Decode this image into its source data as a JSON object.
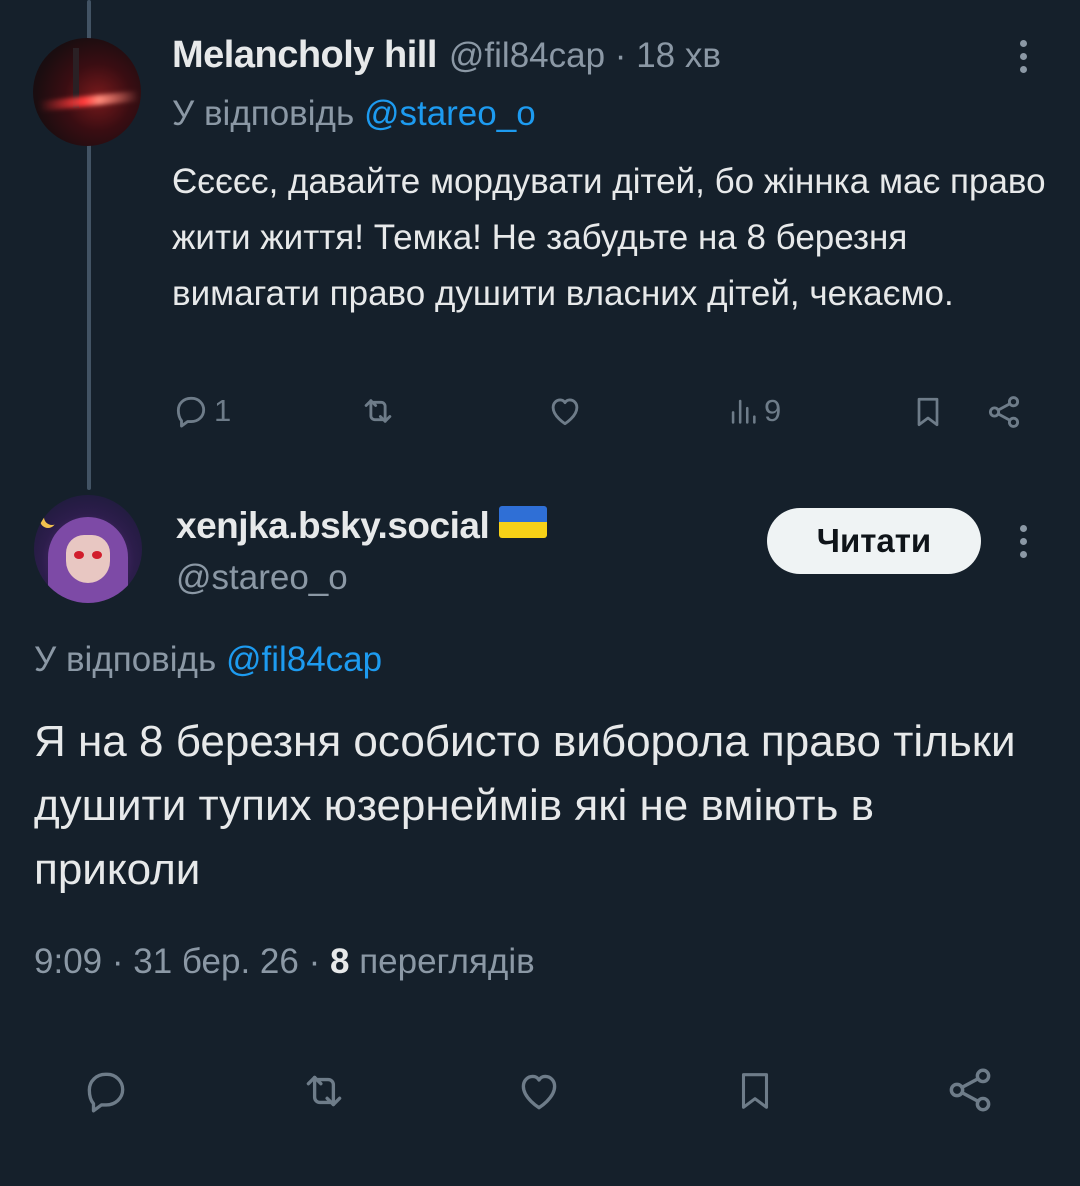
{
  "parent_tweet": {
    "display_name": "Melancholy hill",
    "handle": "@fil84cap",
    "time": "18 хв",
    "separator": "·",
    "reply_label": "У відповідь",
    "reply_handle": "@stareo_o",
    "text": "Єєєєє, давайте мордувати дітей, бо жіннка має право жити життя! Темка! Не забудьте на 8 березня вимагати право душити власних дітей, чекаємо.",
    "actions": {
      "reply_count": "1",
      "retweet_count": "",
      "like_count": "",
      "views_count": "9"
    },
    "icons": [
      "reply-icon",
      "retweet-icon",
      "like-icon",
      "views-icon",
      "bookmark-icon",
      "share-icon",
      "more-icon"
    ]
  },
  "main_tweet": {
    "display_name": "xenjka.bsky.social",
    "flag": "ukraine-flag",
    "handle": "@stareo_o",
    "follow_label": "Читати",
    "reply_label": "У відповідь",
    "reply_handle": "@fil84cap",
    "text": "Я на 8 березня особисто виборола право тільки душити тупих юзернеймів які не вміють в приколи",
    "time": "9:09",
    "date": "31 бер. 26",
    "views_number": "8",
    "views_label": "переглядів",
    "separator": "·",
    "icons": [
      "reply-icon",
      "retweet-icon",
      "like-icon",
      "bookmark-icon",
      "share-icon",
      "more-icon"
    ]
  },
  "colors": {
    "background": "#15202b",
    "text": "#e7e9ea",
    "muted": "#8b98a5",
    "link": "#1d9bf0",
    "thread_line": "#425364",
    "flag_blue": "#2f6fd6",
    "flag_yellow": "#f7d117"
  }
}
